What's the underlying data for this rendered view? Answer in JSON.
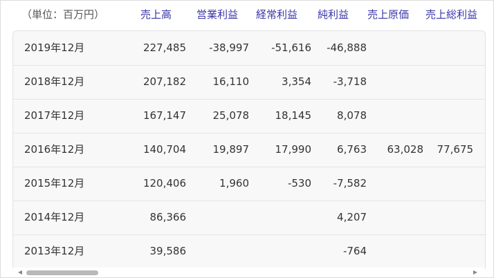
{
  "header": {
    "unit_label": "（単位：百万円）",
    "columns": [
      "売上高",
      "営業利益",
      "経常利益",
      "純利益",
      "売上原価",
      "売上総利益"
    ]
  },
  "rows": [
    {
      "period": "2019年12月",
      "values": [
        "227,485",
        "-38,997",
        "-51,616",
        "-46,888",
        "",
        ""
      ]
    },
    {
      "period": "2018年12月",
      "values": [
        "207,182",
        "16,110",
        "3,354",
        "-3,718",
        "",
        ""
      ]
    },
    {
      "period": "2017年12月",
      "values": [
        "167,147",
        "25,078",
        "18,145",
        "8,078",
        "",
        ""
      ]
    },
    {
      "period": "2016年12月",
      "values": [
        "140,704",
        "19,897",
        "17,990",
        "6,763",
        "63,028",
        "77,675"
      ]
    },
    {
      "period": "2015年12月",
      "values": [
        "120,406",
        "1,960",
        "-530",
        "-7,582",
        "",
        ""
      ]
    },
    {
      "period": "2014年12月",
      "values": [
        "86,366",
        "",
        "",
        "4,207",
        "",
        ""
      ]
    },
    {
      "period": "2013年12月",
      "values": [
        "39,586",
        "",
        "",
        "-764",
        "",
        ""
      ]
    }
  ],
  "scrollbar": {
    "left_arrow_icon": "triangle-left-icon",
    "right_arrow_icon": "triangle-right-icon"
  }
}
